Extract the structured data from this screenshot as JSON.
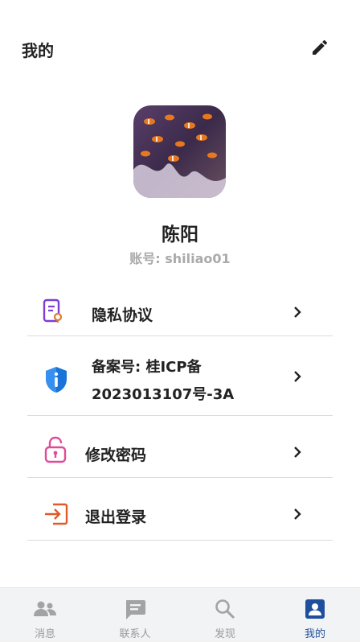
{
  "header": {
    "title": "我的"
  },
  "profile": {
    "name": "陈阳",
    "account": "账号: shiliao01"
  },
  "menu": {
    "privacy": "隐私协议",
    "icp_line1": "备案号: 桂ICP备",
    "icp_line2": "2023013107号-3A",
    "password": "修改密码",
    "logout": "退出登录"
  },
  "tabs": [
    {
      "label": "消息",
      "icon": "people-icon"
    },
    {
      "label": "联系人",
      "icon": "chat-icon"
    },
    {
      "label": "发现",
      "icon": "search-icon"
    },
    {
      "label": "我的",
      "icon": "person-icon"
    }
  ],
  "colors": {
    "accent": "#1e4f9e",
    "privacy_icon": "#7b3fd6",
    "icp_icon": "#1a73d9",
    "password_icon": "#e04a9a",
    "logout_icon": "#e05a2b"
  }
}
